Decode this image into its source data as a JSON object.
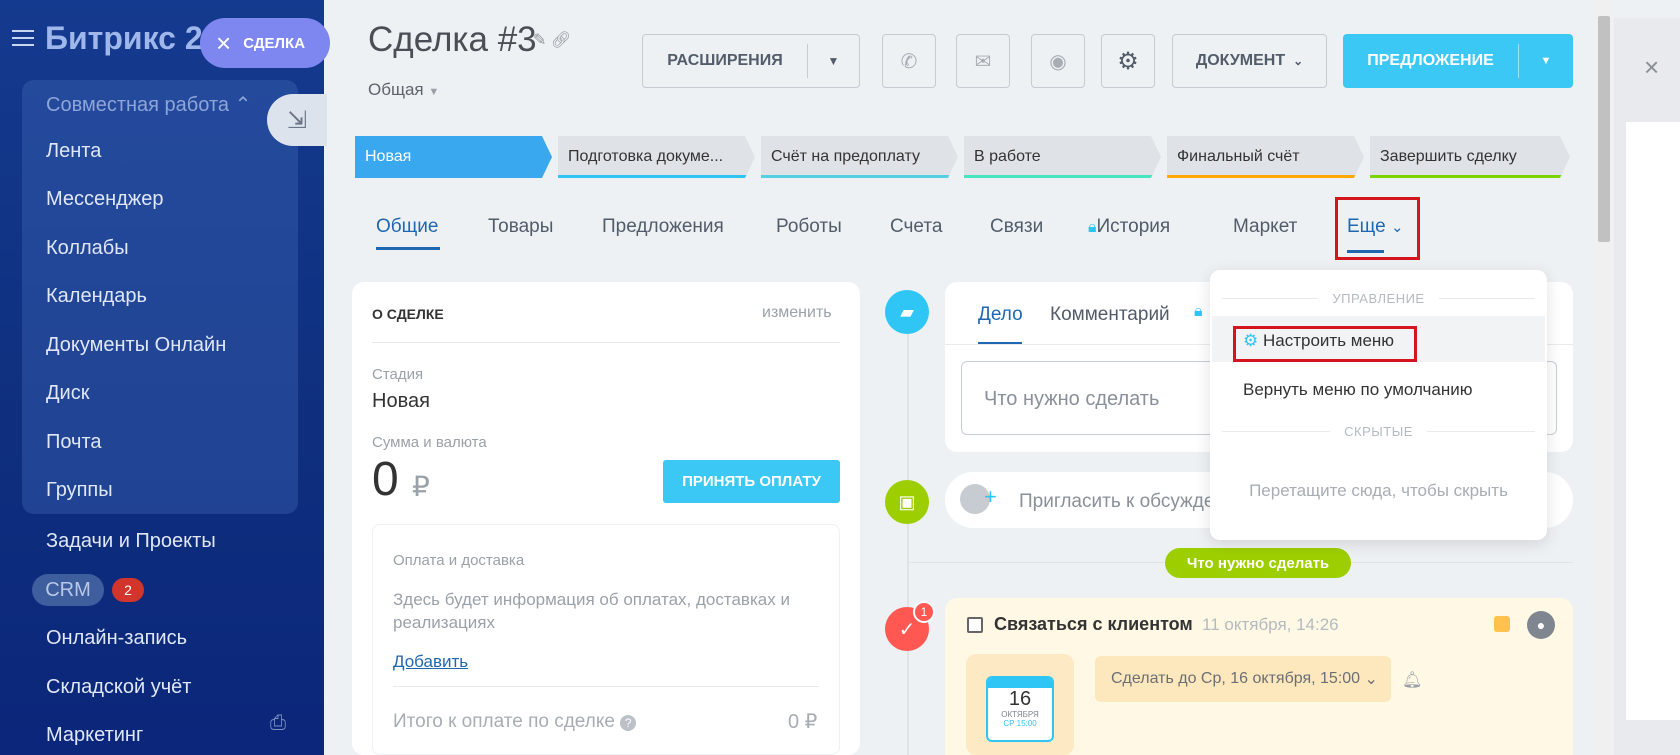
{
  "sidebar": {
    "logo": "Битрикс 24",
    "close_label": "СДЕЛКА",
    "group_header": "Совместная работа",
    "group_items": [
      "Лента",
      "Мессенджер",
      "Коллабы",
      "Календарь",
      "Документы Онлайн",
      "Диск",
      "Почта",
      "Группы"
    ],
    "items": [
      "Задачи и Проекты",
      "Онлайн-запись",
      "Складской учёт",
      "Маркетинг"
    ],
    "crm_label": "CRM",
    "crm_badge": "2"
  },
  "header": {
    "title": "Сделка #3",
    "subtitle": "Общая",
    "extensions_label": "РАСШИРЕНИЯ",
    "document_label": "ДОКУМЕНТ",
    "proposal_label": "ПРЕДЛОЖЕНИЕ"
  },
  "stages": [
    {
      "label": "Новая",
      "color": "#39a8ef"
    },
    {
      "label": "Подготовка докуме...",
      "color": "#2fc6f6"
    },
    {
      "label": "Счёт на предоплату",
      "color": "#55d0e0"
    },
    {
      "label": "В работе",
      "color": "#47e4c2"
    },
    {
      "label": "Финальный счёт",
      "color": "#ffa900"
    },
    {
      "label": "Завершить сделку",
      "color": "#7bd500"
    }
  ],
  "tabs": [
    "Общие",
    "Товары",
    "Предложения",
    "Роботы",
    "Счета",
    "Связи",
    "История",
    "Маркет",
    "Еще"
  ],
  "deal_card": {
    "heading": "О СДЕЛКЕ",
    "edit": "изменить",
    "stage_label": "Стадия",
    "stage_value": "Новая",
    "sum_label": "Сумма и валюта",
    "sum_value": "0",
    "currency": "₽",
    "pay_button": "ПРИНЯТЬ ОПЛАТУ",
    "payment_heading": "Оплата и доставка",
    "payment_text": "Здесь будет информация об оплатах, доставках и реализациях",
    "add_link": "Добавить",
    "total_label": "Итого к оплате по сделке",
    "total_value": "0 ₽"
  },
  "activity": {
    "tab_todo": "Дело",
    "tab_comment": "Комментарий",
    "input_placeholder": "Что нужно сделать",
    "invite_text": "Пригласить к обсужде",
    "deadline_pill": "Что нужно сделать",
    "task_title": "Связаться с клиентом",
    "task_date": "11 октября, 14:26",
    "task_badge": "1",
    "due_text": "Сделать до Ср, 16 октября, 15:00",
    "cal_day": "16",
    "cal_month": "ОКТЯБРЯ",
    "cal_time": "СР 15:00"
  },
  "dropdown": {
    "section_manage": "УПРАВЛЕНИЕ",
    "configure": "Настроить меню",
    "reset": "Вернуть меню по умолчанию",
    "section_hidden": "СКРЫТЫЕ",
    "drag_hint": "Перетащите сюда, чтобы скрыть"
  }
}
